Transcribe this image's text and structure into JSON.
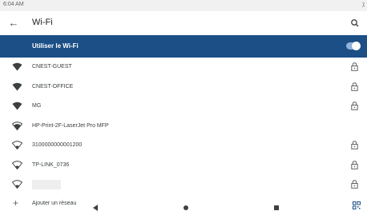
{
  "status_bar": {
    "time": "6:04 AM",
    "right_indicator": "⁒"
  },
  "app_bar": {
    "title": "Wi-Fi",
    "back_icon": "arrow-left-icon",
    "search_icon": "search-icon"
  },
  "wifi_toggle": {
    "label": "Utiliser le Wi-Fi",
    "enabled": true,
    "accent": "#1b4f86"
  },
  "networks": [
    {
      "name": "CNEST-GUEST",
      "signal": "full",
      "locked": true
    },
    {
      "name": "CNEST-OFFICE",
      "signal": "full",
      "locked": true
    },
    {
      "name": "MG",
      "signal": "full",
      "locked": true
    },
    {
      "name": "HP-Print-2F-LaserJet Pro MFP",
      "signal": "strong",
      "locked": false
    },
    {
      "name": "3100000000001200",
      "signal": "weak",
      "locked": true
    },
    {
      "name": "TP-LINK_0736",
      "signal": "weak",
      "locked": true
    },
    {
      "name": "",
      "signal": "weak",
      "locked": true
    }
  ],
  "add_network": {
    "label": "Ajouter un réseau",
    "icon": "plus-icon"
  },
  "nav": {
    "back_icon": "nav-back-icon",
    "home_icon": "nav-home-icon",
    "recents_icon": "nav-recents-icon"
  },
  "qr_icon": "qr-scan-icon"
}
